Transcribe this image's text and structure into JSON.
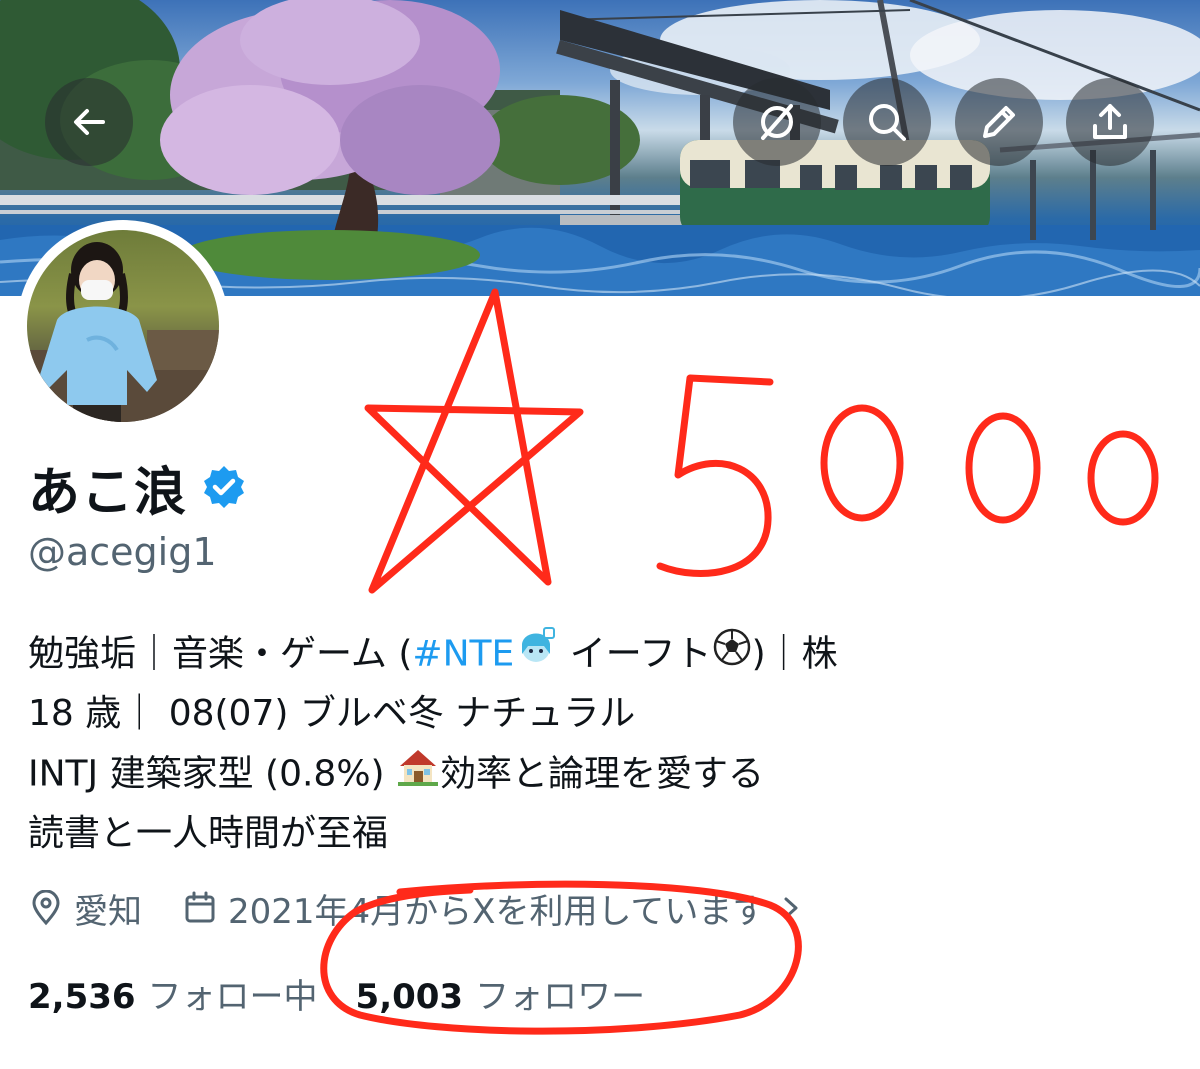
{
  "header": {
    "back_icon": "arrow-left-icon",
    "actions": [
      "mute-icon",
      "search-icon",
      "pencil-icon",
      "share-icon"
    ]
  },
  "profile": {
    "display_name": "あこ浪",
    "handle": "@acegig1",
    "verified": true,
    "bio": {
      "line1_a": "勉強垢｜音楽・ゲーム (",
      "line1_hashtag": "#NTE",
      "line1_b": " イーフト",
      "line1_c": ")｜株",
      "line2": "18 歳｜ 08(07) ブルベ冬 ナチュラル",
      "line3_a": "INTJ 建築家型 (0.8%) ",
      "line3_b": "効率と論理を愛する",
      "line4": "読書と一人時間が至福"
    },
    "location": "愛知",
    "joined": "2021年4月からXを利用しています"
  },
  "stats": {
    "following_count": "2,536",
    "following_label": "フォロー中",
    "followers_count": "5,003",
    "followers_label": "フォロワー"
  },
  "annotation": {
    "handwritten_text": "☆5000",
    "color": "#ff2a1a"
  },
  "colors": {
    "accent": "#1d9bf0",
    "text": "#0f1419",
    "muted": "#536471"
  }
}
